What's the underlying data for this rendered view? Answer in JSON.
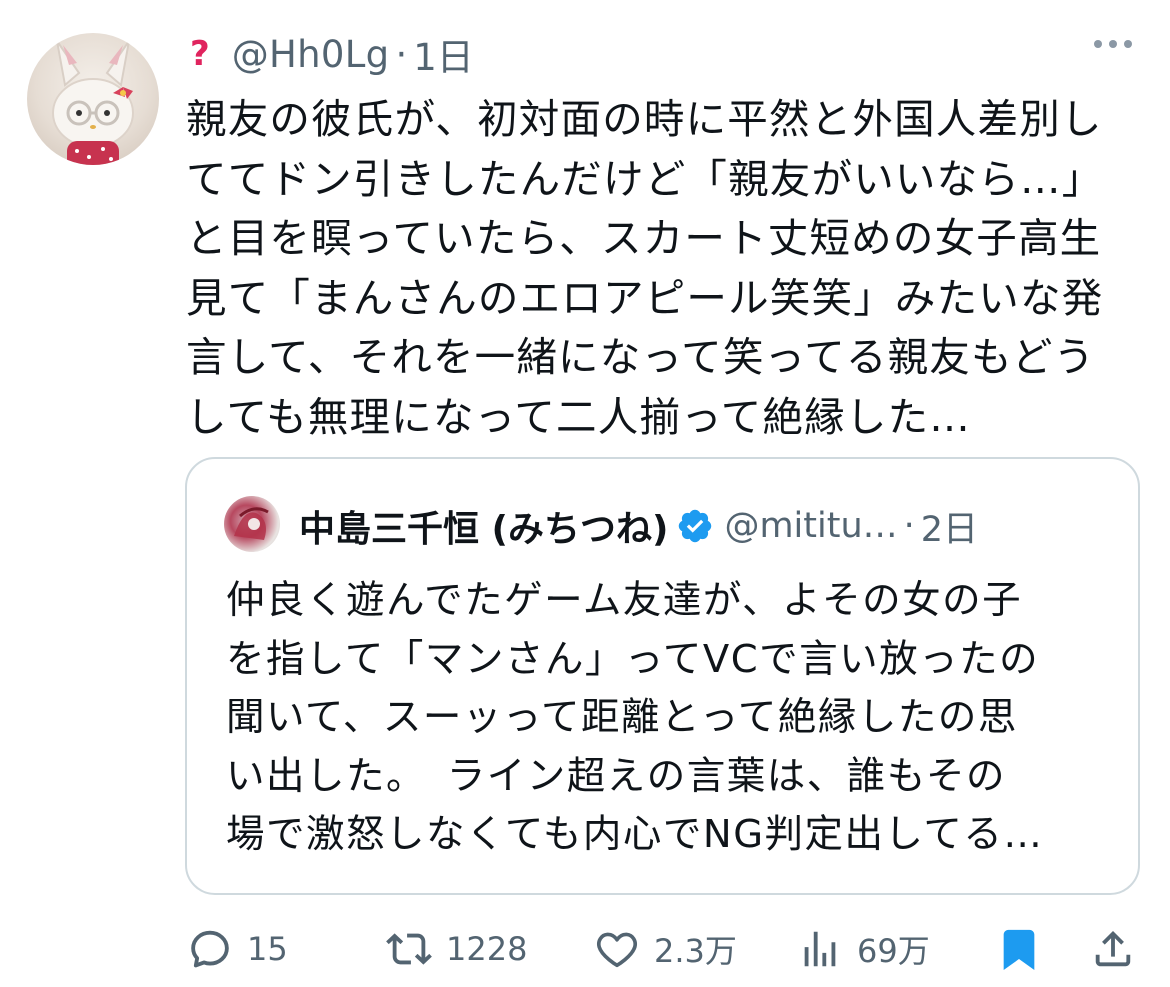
{
  "tweet": {
    "author_badge_icon": "red-question-mark-icon",
    "handle": "@Hh0Lg",
    "separator": "·",
    "time": "1日",
    "more_icon": "more-horizontal-icon",
    "lines": [
      "親友の彼氏が、初対面の時に平然と外国人差別し",
      "ててドン引きしたんだけど「親友がいいなら…」",
      "と目を瞑っていたら、スカート丈短めの女子高生",
      "見て「まんさんのエロアピール笑笑」みたいな発",
      "言して、それを一緒になって笑ってる親友もどう",
      "しても無理になって二人揃って絶縁した…"
    ]
  },
  "quote": {
    "name": "中島三千恒 (みちつね)",
    "verified_icon": "verified-badge-icon",
    "handle": "@mititu…",
    "separator": "·",
    "time": "2日",
    "lines": [
      "仲良く遊んでたゲーム友達が、よその女の子",
      "を指して「マンさん」ってVCで言い放ったの",
      "聞いて、スーッって距離とって絶縁したの思",
      "い出した。　ライン超えの言葉は、誰もその",
      "場で激怒しなくても内心でNG判定出してる…"
    ]
  },
  "actions": {
    "reply": {
      "icon": "reply-icon",
      "count": "15"
    },
    "retweet": {
      "icon": "retweet-icon",
      "count": "1228"
    },
    "like": {
      "icon": "heart-icon",
      "count": "2.3万"
    },
    "views": {
      "icon": "views-chart-icon",
      "count": "69万"
    },
    "bookmark": {
      "icon": "bookmark-filled-icon"
    },
    "share": {
      "icon": "share-icon"
    }
  },
  "colors": {
    "text": "#0f1419",
    "muted": "#536471",
    "accent": "#1d9bf0",
    "border": "#cfd9de"
  }
}
